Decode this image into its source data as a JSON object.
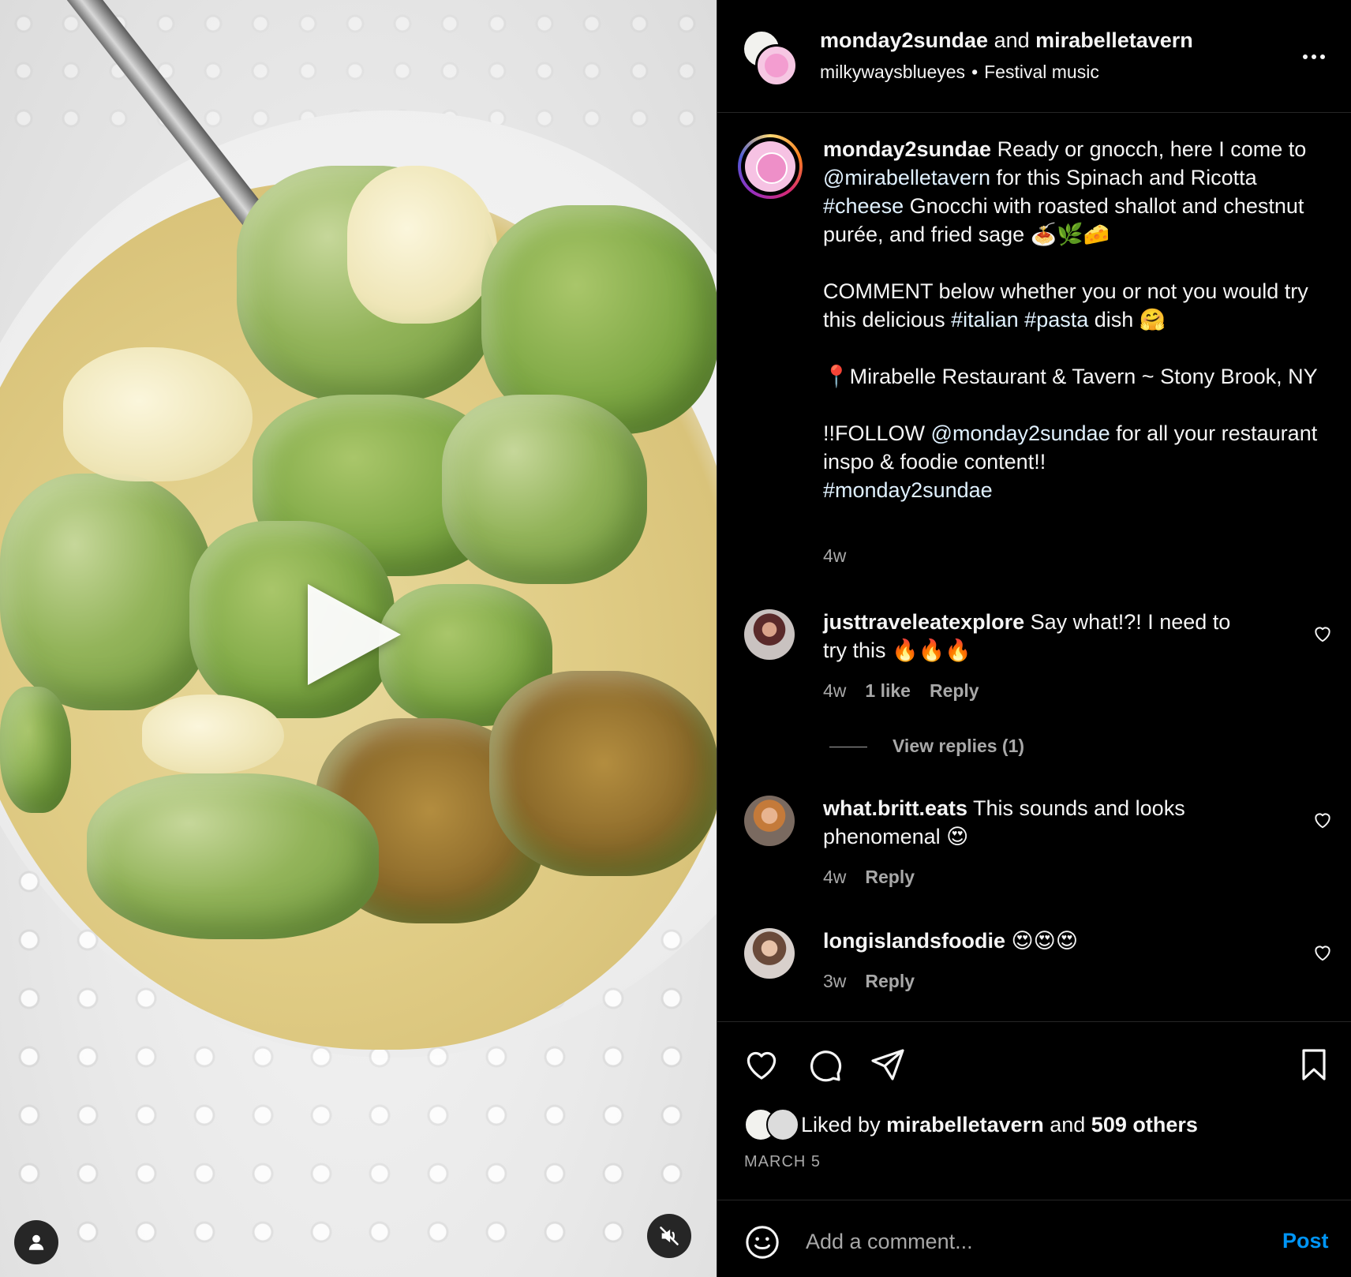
{
  "post": {
    "header": {
      "author": "monday2sundae",
      "joiner": "and",
      "collaborator": "mirabelletavern",
      "audio_user": "milkywaysblueyes",
      "audio_separator": "•",
      "audio_track": "Festival music"
    },
    "caption": {
      "author": "monday2sundae",
      "line1_pre": "Ready or gnocch, here I come to ",
      "mention1": "@mirabelletavern",
      "line1_mid": " for this Spinach and Ricotta ",
      "hashtag1": "#cheese",
      "line1_post": " Gnocchi with roasted shallot and chestnut purée, and fried sage 🍝🌿🧀",
      "para2_pre": "COMMENT below whether you or not you would try this delicious ",
      "hashtag2": "#italian",
      "hashtag3": "#pasta",
      "para2_post": " dish 🤗",
      "para3": "📍Mirabelle Restaurant & Tavern ~ Stony Brook, NY",
      "para4_pre": "!!FOLLOW ",
      "mention2": "@monday2sundae",
      "para4_post": " for all your restaurant inspo & foodie content!!",
      "hashtag4": "#monday2sundae",
      "time": "4w"
    },
    "comments": [
      {
        "user": "justtraveleatexplore",
        "text": "Say what!?! I need to try this 🔥🔥🔥",
        "time": "4w",
        "likes": "1 like",
        "reply": "Reply",
        "view_replies": "View replies (1)"
      },
      {
        "user": "what.britt.eats",
        "text": "This sounds and looks phenomenal 😍",
        "time": "4w",
        "reply": "Reply"
      },
      {
        "user": "longislandsfoodie",
        "text": "😍😍😍",
        "time": "3w",
        "reply": "Reply"
      }
    ],
    "likes": {
      "prefix": "Liked by",
      "liker": "mirabelletavern",
      "joiner": "and",
      "others": "509 others"
    },
    "date": "MARCH 5",
    "add_comment": {
      "placeholder": "Add a comment...",
      "post_label": "Post"
    }
  },
  "icons": {
    "play": "play-icon",
    "user_tag": "person-icon",
    "mute": "speaker-muted-icon",
    "more": "more-horizontal-icon",
    "like": "heart-icon",
    "comment": "comment-bubble-icon",
    "share": "paper-plane-icon",
    "save": "bookmark-icon",
    "emoji": "emoji-smile-icon"
  },
  "colors": {
    "background": "#000000",
    "text": "#f5f5f5",
    "secondary_text": "#a8a8a8",
    "link": "#e0f1ff",
    "post_button": "#0095f6",
    "divider": "#262626"
  }
}
